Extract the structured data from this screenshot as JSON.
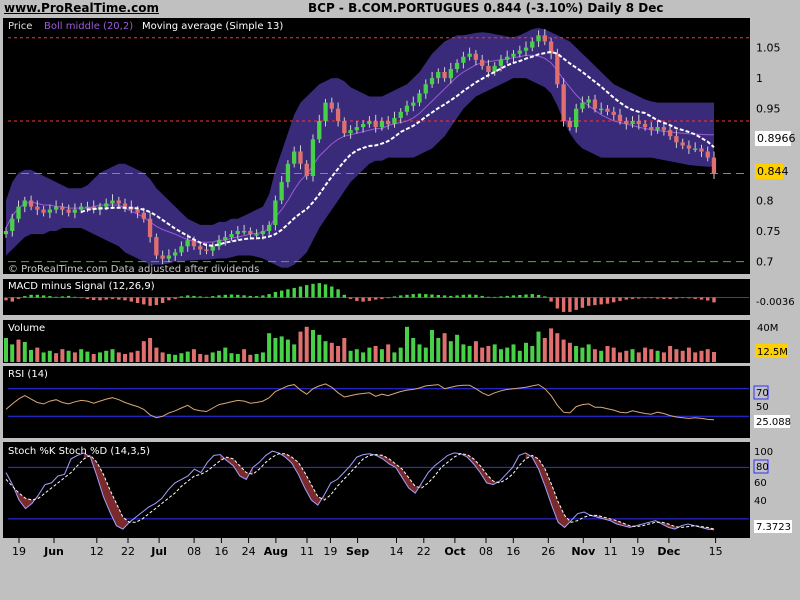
{
  "header": {
    "site": "www.ProRealTime.com",
    "title": "BCP - B.COM.PORTUGUES    0.844 (-3.10%)    Daily  8 Dec"
  },
  "chart_data": [
    {
      "type": "candlestick",
      "panel": "Price",
      "legend": [
        "Price",
        "Boll middle (20,2)",
        "Moving average (Simple 13)"
      ],
      "legend_colors": [
        "#e0e0e0",
        "#9b5bd6",
        "#ffffff"
      ],
      "note": "© ProRealTime.com  Data adjusted after dividends",
      "y_ticks": [
        0.7,
        0.75,
        0.8,
        0.85,
        0.9,
        0.95,
        1,
        1.05
      ],
      "y_tick_labels": [
        "0.7",
        "0.75",
        "0.8",
        "0.85",
        "0.9",
        "0.95",
        "1",
        "1.05"
      ],
      "ylim": [
        0.683,
        1.082
      ],
      "last_value": "0.844",
      "bb_marker": "0.8966",
      "horizontal_lines": [
        {
          "y": 1.066,
          "color": "#ff3030",
          "style": "dashed"
        },
        {
          "y": 0.93,
          "color": "#ff3030",
          "style": "dashed"
        },
        {
          "y": 0.844,
          "color": "#28c828",
          "style": "dashed"
        },
        {
          "y": 0.7,
          "color": "#28c828",
          "style": "dashed"
        }
      ],
      "close": [
        0.75,
        0.77,
        0.79,
        0.8,
        0.79,
        0.785,
        0.78,
        0.785,
        0.79,
        0.785,
        0.78,
        0.785,
        0.79,
        0.79,
        0.785,
        0.79,
        0.795,
        0.8,
        0.795,
        0.79,
        0.785,
        0.78,
        0.77,
        0.74,
        0.71,
        0.705,
        0.71,
        0.715,
        0.725,
        0.735,
        0.725,
        0.72,
        0.718,
        0.725,
        0.735,
        0.74,
        0.745,
        0.75,
        0.75,
        0.745,
        0.745,
        0.75,
        0.76,
        0.8,
        0.83,
        0.86,
        0.88,
        0.86,
        0.84,
        0.9,
        0.93,
        0.96,
        0.95,
        0.93,
        0.91,
        0.915,
        0.92,
        0.925,
        0.93,
        0.92,
        0.93,
        0.925,
        0.935,
        0.945,
        0.955,
        0.96,
        0.975,
        0.99,
        1.0,
        1.01,
        1.0,
        1.015,
        1.025,
        1.035,
        1.04,
        1.03,
        1.02,
        1.01,
        1.02,
        1.03,
        1.035,
        1.04,
        1.045,
        1.05,
        1.06,
        1.07,
        1.06,
        1.04,
        0.99,
        0.93,
        0.92,
        0.95,
        0.96,
        0.965,
        0.95,
        0.95,
        0.945,
        0.94,
        0.93,
        0.925,
        0.93,
        0.925,
        0.92,
        0.915,
        0.92,
        0.915,
        0.905,
        0.895,
        0.89,
        0.885,
        0.885,
        0.88,
        0.87,
        0.844
      ],
      "bb_upper": [
        0.8,
        0.83,
        0.845,
        0.85,
        0.85,
        0.845,
        0.84,
        0.835,
        0.83,
        0.825,
        0.82,
        0.82,
        0.82,
        0.825,
        0.835,
        0.845,
        0.85,
        0.855,
        0.86,
        0.86,
        0.855,
        0.85,
        0.845,
        0.835,
        0.82,
        0.81,
        0.8,
        0.79,
        0.78,
        0.77,
        0.765,
        0.76,
        0.76,
        0.76,
        0.765,
        0.765,
        0.77,
        0.77,
        0.775,
        0.78,
        0.785,
        0.79,
        0.81,
        0.85,
        0.88,
        0.91,
        0.94,
        0.96,
        0.97,
        0.98,
        0.99,
        0.995,
        1.0,
        1.0,
        0.995,
        0.985,
        0.98,
        0.975,
        0.97,
        0.97,
        0.97,
        0.975,
        0.98,
        0.985,
        0.99,
        1.0,
        1.01,
        1.025,
        1.04,
        1.05,
        1.06,
        1.065,
        1.07,
        1.07,
        1.072,
        1.074,
        1.075,
        1.074,
        1.072,
        1.07,
        1.068,
        1.067,
        1.07,
        1.075,
        1.08,
        1.082,
        1.08,
        1.075,
        1.07,
        1.065,
        1.06,
        1.05,
        1.04,
        1.03,
        1.02,
        1.01,
        1.0,
        0.99,
        0.985,
        0.98,
        0.975,
        0.97,
        0.965,
        0.962,
        0.96,
        0.96,
        0.96,
        0.96,
        0.96,
        0.96,
        0.96,
        0.96,
        0.96,
        0.96
      ],
      "bb_lower": [
        0.71,
        0.72,
        0.73,
        0.74,
        0.745,
        0.745,
        0.745,
        0.75,
        0.75,
        0.755,
        0.755,
        0.755,
        0.755,
        0.75,
        0.745,
        0.74,
        0.735,
        0.73,
        0.725,
        0.715,
        0.71,
        0.705,
        0.7,
        0.695,
        0.695,
        0.695,
        0.697,
        0.7,
        0.7,
        0.702,
        0.702,
        0.703,
        0.703,
        0.704,
        0.705,
        0.705,
        0.707,
        0.71,
        0.71,
        0.71,
        0.708,
        0.705,
        0.7,
        0.695,
        0.69,
        0.69,
        0.695,
        0.705,
        0.715,
        0.735,
        0.755,
        0.77,
        0.785,
        0.8,
        0.815,
        0.83,
        0.84,
        0.85,
        0.86,
        0.865,
        0.865,
        0.87,
        0.87,
        0.87,
        0.87,
        0.87,
        0.875,
        0.88,
        0.885,
        0.895,
        0.905,
        0.92,
        0.935,
        0.95,
        0.96,
        0.97,
        0.975,
        0.98,
        0.985,
        0.99,
        0.995,
        1.0,
        1.0,
        1.0,
        0.995,
        0.99,
        0.985,
        0.975,
        0.955,
        0.93,
        0.91,
        0.895,
        0.885,
        0.88,
        0.875,
        0.87,
        0.87,
        0.87,
        0.87,
        0.87,
        0.87,
        0.87,
        0.87,
        0.87,
        0.868,
        0.866,
        0.864,
        0.862,
        0.86,
        0.858,
        0.857,
        0.856,
        0.855,
        0.855
      ],
      "ma13": [
        null,
        null,
        null,
        null,
        null,
        null,
        null,
        null,
        null,
        null,
        null,
        null,
        0.781,
        0.785,
        0.786,
        0.787,
        0.787,
        0.788,
        0.788,
        0.788,
        0.788,
        0.787,
        0.785,
        0.781,
        0.775,
        0.768,
        0.761,
        0.754,
        0.748,
        0.742,
        0.736,
        0.731,
        0.727,
        0.726,
        0.728,
        0.731,
        0.733,
        0.735,
        0.737,
        0.738,
        0.738,
        0.739,
        0.741,
        0.745,
        0.752,
        0.761,
        0.771,
        0.779,
        0.786,
        0.797,
        0.81,
        0.825,
        0.839,
        0.852,
        0.864,
        0.875,
        0.882,
        0.886,
        0.889,
        0.89,
        0.893,
        0.897,
        0.904,
        0.912,
        0.917,
        0.922,
        0.929,
        0.937,
        0.944,
        0.951,
        0.957,
        0.964,
        0.971,
        0.979,
        0.986,
        0.993,
        0.999,
        1.005,
        1.01,
        1.016,
        1.021,
        1.025,
        1.028,
        1.032,
        1.035,
        1.039,
        1.041,
        1.043,
        1.04,
        1.032,
        1.024,
        1.017,
        1.01,
        1.002,
        0.994,
        0.986,
        0.977,
        0.968,
        0.96,
        0.953,
        0.948,
        0.945,
        0.943,
        0.937,
        0.931,
        0.927,
        0.923,
        0.918,
        0.915,
        0.912,
        0.908,
        0.902,
        0.896,
        0.887
      ]
    },
    {
      "type": "histogram",
      "panel": "MACD minus Signal",
      "legend": [
        "MACD minus Signal (12,26,9)"
      ],
      "last_value": "-0.0036",
      "zero_line": 0,
      "ylim": [
        -0.012,
        0.012
      ],
      "values": [
        -0.002,
        -0.003,
        -0.001,
        0.001,
        0.002,
        0.002,
        0.0015,
        0.001,
        0.0005,
        0.0008,
        0.0012,
        0.0005,
        -0.0005,
        -0.0012,
        -0.0018,
        -0.002,
        -0.0015,
        -0.001,
        -0.0015,
        -0.002,
        -0.003,
        -0.004,
        -0.005,
        -0.006,
        -0.0055,
        -0.004,
        -0.002,
        -0.001,
        0.0008,
        0.0015,
        0.0012,
        0.0008,
        0.0005,
        0.001,
        0.0016,
        0.002,
        0.0022,
        0.002,
        0.0016,
        0.0012,
        0.001,
        0.0015,
        0.0025,
        0.004,
        0.005,
        0.006,
        0.007,
        0.008,
        0.009,
        0.01,
        0.0105,
        0.0095,
        0.008,
        0.006,
        0.002,
        -0.001,
        -0.0025,
        -0.003,
        -0.0025,
        -0.0015,
        -0.001,
        -0.0005,
        0.0008,
        0.0015,
        0.002,
        0.0025,
        0.0028,
        0.0025,
        0.0022,
        0.0018,
        0.0015,
        0.0012,
        0.0015,
        0.002,
        0.0022,
        0.002,
        0.0012,
        0.0005,
        0.0004,
        0.0008,
        0.0012,
        0.0015,
        0.0018,
        0.0022,
        0.0025,
        0.0018,
        0.0008,
        -0.003,
        -0.008,
        -0.0105,
        -0.0105,
        -0.009,
        -0.0075,
        -0.006,
        -0.0055,
        -0.005,
        -0.0045,
        -0.0035,
        -0.0025,
        -0.0015,
        -0.001,
        -0.0008,
        -0.0006,
        -0.0005,
        -0.0008,
        -0.001,
        -0.0012,
        -0.0008,
        -0.0004,
        -0.0006,
        -0.001,
        -0.0015,
        -0.0022,
        -0.0036
      ]
    },
    {
      "type": "bar",
      "panel": "Volume",
      "legend": [
        "Volume"
      ],
      "y_tick_labels": [
        "40M",
        "20M"
      ],
      "y_ticks": [
        40,
        20
      ],
      "ylim": [
        0,
        50
      ],
      "unit": "M",
      "last_value": "12.5M",
      "values": [
        30,
        22,
        28,
        25,
        15,
        18,
        12,
        14,
        11,
        16,
        14,
        12,
        16,
        13,
        10,
        12,
        14,
        16,
        12,
        10,
        12,
        14,
        26,
        30,
        18,
        12,
        10,
        9,
        11,
        13,
        16,
        10,
        9,
        12,
        14,
        18,
        11,
        10,
        16,
        9,
        10,
        12,
        36,
        30,
        32,
        28,
        22,
        38,
        44,
        40,
        34,
        26,
        24,
        20,
        30,
        14,
        16,
        12,
        18,
        20,
        16,
        22,
        12,
        18,
        44,
        30,
        22,
        18,
        40,
        30,
        36,
        26,
        34,
        22,
        20,
        26,
        18,
        20,
        22,
        16,
        18,
        22,
        14,
        24,
        20,
        38,
        30,
        42,
        36,
        28,
        24,
        20,
        18,
        22,
        16,
        14,
        20,
        18,
        12,
        14,
        16,
        12,
        18,
        16,
        14,
        12,
        20,
        16,
        14,
        18,
        12,
        14,
        16,
        12.5
      ],
      "up": [
        1,
        1,
        0,
        1,
        1,
        0,
        1,
        1,
        0,
        0,
        1,
        0,
        1,
        1,
        0,
        1,
        1,
        1,
        0,
        0,
        0,
        0,
        0,
        0,
        0,
        0,
        1,
        1,
        1,
        1,
        0,
        0,
        0,
        1,
        1,
        1,
        1,
        1,
        0,
        0,
        1,
        1,
        1,
        1,
        1,
        1,
        1,
        0,
        0,
        1,
        1,
        1,
        0,
        0,
        0,
        1,
        1,
        1,
        1,
        0,
        1,
        0,
        1,
        1,
        1,
        1,
        1,
        1,
        1,
        1,
        0,
        1,
        1,
        1,
        1,
        0,
        0,
        0,
        1,
        1,
        1,
        1,
        1,
        1,
        1,
        1,
        0,
        0,
        0,
        0,
        0,
        1,
        1,
        1,
        0,
        1,
        0,
        0,
        0,
        0,
        1,
        0,
        0,
        0,
        1,
        0,
        0,
        0,
        0,
        0,
        0,
        0,
        0,
        0
      ]
    },
    {
      "type": "line",
      "panel": "RSI",
      "legend": [
        "RSI (14)"
      ],
      "y_tick_labels": [
        "70",
        "50",
        "25.088"
      ],
      "ylim": [
        0,
        100
      ],
      "levels": [
        70,
        30
      ],
      "last_value": "25.088",
      "values": [
        40,
        48,
        55,
        60,
        55,
        50,
        48,
        52,
        54,
        50,
        48,
        51,
        53,
        52,
        49,
        52,
        55,
        57,
        54,
        50,
        47,
        44,
        40,
        32,
        28,
        30,
        35,
        38,
        42,
        46,
        40,
        38,
        37,
        42,
        47,
        49,
        51,
        53,
        52,
        49,
        50,
        52,
        57,
        66,
        70,
        74,
        76,
        68,
        62,
        70,
        74,
        77,
        72,
        64,
        58,
        60,
        62,
        63,
        64,
        59,
        62,
        60,
        63,
        66,
        68,
        69,
        71,
        74,
        75,
        76,
        70,
        72,
        74,
        75,
        75,
        70,
        64,
        60,
        64,
        67,
        69,
        70,
        71,
        72,
        74,
        76,
        70,
        60,
        46,
        36,
        35,
        44,
        47,
        48,
        43,
        43,
        41,
        39,
        36,
        35,
        38,
        36,
        34,
        33,
        36,
        34,
        31,
        29,
        28,
        27,
        28,
        27,
        25.5,
        25.088
      ]
    },
    {
      "type": "line",
      "panel": "Stochastic",
      "legend": [
        "Stoch %K Stoch %D (14,3,5)"
      ],
      "y_tick_labels": [
        "100",
        "80",
        "60",
        "40",
        "7.3723"
      ],
      "y_ticks": [
        100,
        80,
        60,
        40
      ],
      "ylim": [
        0,
        105
      ],
      "levels": [
        80,
        20
      ],
      "last_value": "7.3723",
      "k": [
        74,
        60,
        42,
        32,
        38,
        48,
        60,
        62,
        70,
        72,
        90,
        94,
        97,
        92,
        70,
        46,
        28,
        12,
        8,
        16,
        22,
        28,
        34,
        38,
        44,
        54,
        62,
        66,
        70,
        78,
        74,
        86,
        94,
        95,
        88,
        82,
        70,
        66,
        80,
        86,
        94,
        99,
        97,
        92,
        85,
        72,
        56,
        42,
        36,
        48,
        62,
        66,
        74,
        82,
        92,
        95,
        96,
        94,
        90,
        84,
        80,
        68,
        56,
        50,
        62,
        74,
        82,
        88,
        94,
        97,
        96,
        92,
        84,
        74,
        62,
        60,
        64,
        72,
        80,
        94,
        97,
        92,
        78,
        58,
        36,
        16,
        10,
        18,
        26,
        28,
        24,
        22,
        20,
        18,
        14,
        12,
        10,
        12,
        14,
        16,
        18,
        14,
        10,
        8,
        12,
        14,
        12,
        10,
        8,
        7.3723
      ],
      "d": [
        66,
        58,
        50,
        44,
        42,
        44,
        50,
        56,
        62,
        68,
        74,
        82,
        90,
        94,
        86,
        72,
        54,
        38,
        22,
        16,
        16,
        20,
        26,
        32,
        38,
        44,
        50,
        58,
        64,
        70,
        72,
        76,
        82,
        88,
        92,
        90,
        82,
        74,
        72,
        78,
        86,
        92,
        96,
        96,
        92,
        86,
        74,
        60,
        46,
        42,
        48,
        58,
        66,
        74,
        82,
        90,
        94,
        95,
        94,
        90,
        84,
        78,
        68,
        58,
        56,
        62,
        70,
        80,
        86,
        92,
        96,
        95,
        90,
        82,
        72,
        64,
        62,
        66,
        72,
        82,
        90,
        94,
        90,
        78,
        60,
        40,
        24,
        16,
        18,
        22,
        24,
        24,
        22,
        20,
        18,
        15,
        12,
        11,
        12,
        14,
        16,
        16,
        14,
        11,
        10,
        11,
        12,
        11,
        10,
        8
      ]
    }
  ],
  "x_axis": {
    "labels": [
      "19",
      "Jun",
      "12",
      "22",
      "Jul",
      "08",
      "16",
      "24",
      "Aug",
      "11",
      "19",
      "Sep",
      "14",
      "22",
      "Oct",
      "08",
      "16",
      "26",
      "Nov",
      "11",
      "19",
      "Dec",
      "15"
    ],
    "bold": [
      "Jun",
      "Jul",
      "Aug",
      "Sep",
      "Oct",
      "Nov",
      "Dec"
    ],
    "label_bar_index": [
      0,
      9,
      20,
      28,
      36,
      45,
      52,
      59,
      66,
      74,
      80,
      87,
      97,
      104,
      112,
      120,
      127,
      136,
      145,
      152,
      159,
      167,
      179
    ]
  },
  "colors": {
    "background": "#000000",
    "frame": "#c0c0c0",
    "candle_up": "#48d048",
    "candle_down": "#e07070",
    "band_fill": "#3a2a7a",
    "boll_middle": "#9b5bd6",
    "ma_line": "#ffffff",
    "level_line": "#3030ff",
    "rsi_line": "#d8a878",
    "k_line": "#a0a0ff",
    "d_line": "#ffffff",
    "stoch_fill": "#7a2a2a",
    "text": "#ffffff",
    "marker_highlight": "#ffd000"
  }
}
